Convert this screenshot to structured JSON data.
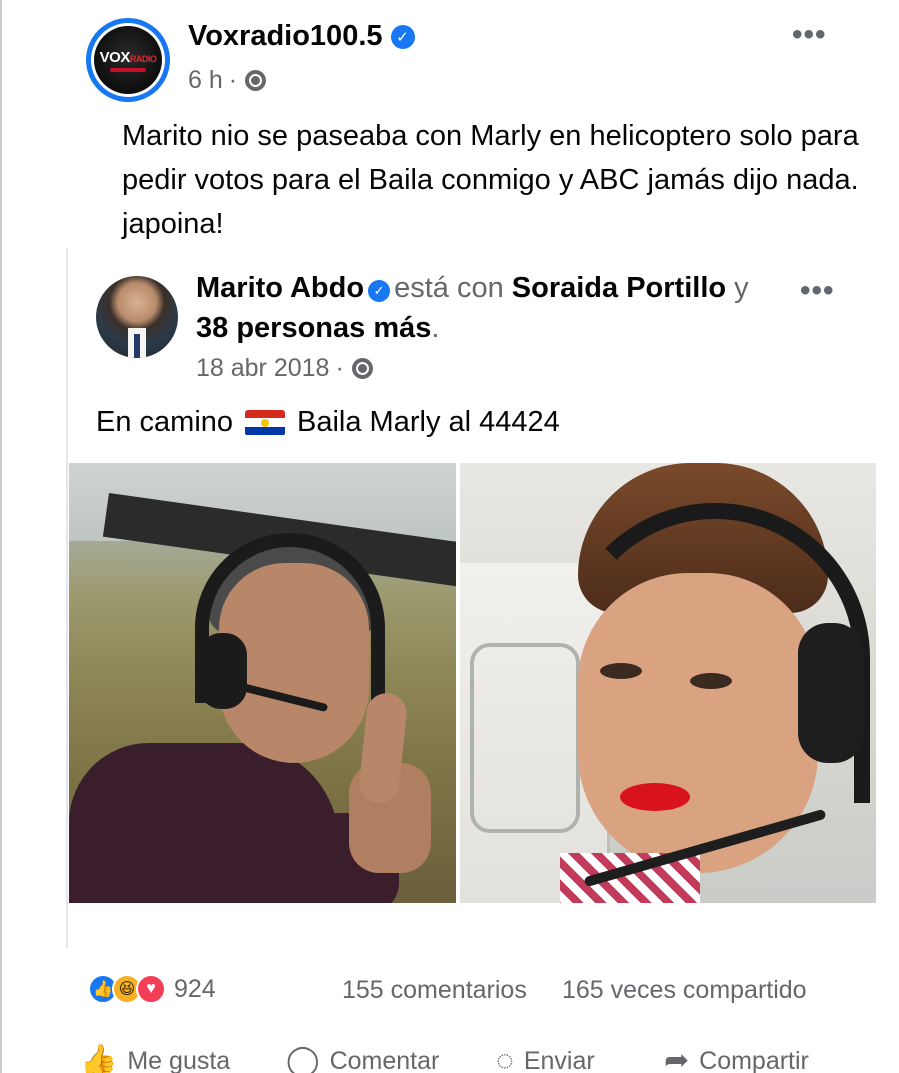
{
  "post": {
    "page_name": "Voxradio100.5",
    "time": "6 h",
    "meta_separator": "·",
    "logo_text": "VOX",
    "logo_sub": "RADIO",
    "text": "Marito nio se paseaba con Marly en helicoptero solo para pedir votos para el Baila conmigo y ABC jamás dijo nada. japoina!",
    "options_icon": "more-dots-icon"
  },
  "shared_post": {
    "author": "Marito Abdo",
    "with_label": "está con",
    "tagged": "Soraida Portillo",
    "and_label": "y",
    "others": "38 personas más",
    "period": ".",
    "date": "18 abr 2018",
    "meta_separator": "·",
    "text_before_flag": "En camino",
    "flag_icon": "paraguay-flag-icon",
    "text_after_flag": "Baila Marly al 44424"
  },
  "reactions": {
    "icons": [
      "like-icon",
      "haha-icon",
      "love-icon"
    ],
    "count": "924",
    "comments": "155 comentarios",
    "shares": "165 veces compartido"
  },
  "actions": {
    "like": "Me gusta",
    "comment": "Comentar",
    "send": "Enviar",
    "share": "Compartir"
  },
  "colors": {
    "accent": "#1877f2",
    "secondary_text": "#65676b",
    "love": "#f33e58",
    "haha": "#f7b125"
  }
}
